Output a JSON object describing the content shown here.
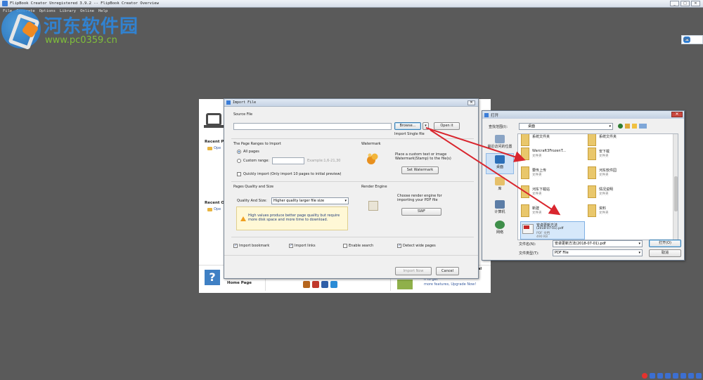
{
  "app": {
    "title": "FlipBook Creator Unregistered 3.9.2  -- FlipBook Creator Overview",
    "menu": [
      "File",
      "Generate",
      "Options",
      "Library",
      "Online",
      "Help"
    ],
    "window_buttons": [
      "_",
      "□",
      "✕"
    ]
  },
  "watermark": {
    "name": "河东软件园",
    "url": "www.pc0359.cn"
  },
  "right_badge": {
    "label": "相关"
  },
  "welcome": {
    "recent_projects_label": "Recent P",
    "recent_projects_open": "Ope",
    "recent_output_label": "Recent O",
    "recent_output_open": "Ope",
    "home_page": "Home Page",
    "help_icon": "?",
    "upgrade_partial_title": "al",
    "upgrade_text_line1": "n to get",
    "upgrade_text_line2": "more features, Upgrade Now!"
  },
  "import_dialog": {
    "title": "Import File",
    "close": "✕",
    "source_file_label": "Source File",
    "source_file_value": "",
    "browse_button": "Browse...",
    "open_it_button": "Open it",
    "import_single_file": "Import Single file",
    "page_ranges_label": "The Page Ranges to Import",
    "all_pages": "All pages",
    "custom_range": "Custom range:",
    "custom_range_example": "Example:1,6-21,30",
    "quickly_import": "Quickly import (Only import 10 pages to  initial  preview)",
    "watermark_label": "Watermark",
    "watermark_desc": "Place a custom text or image Watermark(Stamp) to the file(s)",
    "set_watermark_button": "Set Watermark",
    "quality_label": "Pages Quality and Size",
    "quality_and_size": "Quality And Size:",
    "quality_selected": "Higher quality larger file size",
    "quality_warning": "High values produce better page quality but require more disk space and more time to download.",
    "render_label": "Render Engine",
    "render_desc": "Choose render engine for importing your PDF file",
    "swf_button": "SWF",
    "import_bookmark": "Import bookmark",
    "import_links": "Import links",
    "enable_search": "Enable search",
    "detect_wide_pages": "Detect wide pages",
    "import_now_button": "Import Now",
    "cancel_button": "Cancel",
    "checks": {
      "import_bookmark": true,
      "import_links": true,
      "enable_search": false,
      "detect_wide_pages": true,
      "quickly_import": false
    },
    "all_pages_selected": true
  },
  "open_dialog": {
    "title": "打开",
    "look_in_label": "查找范围(I):",
    "look_in_value": "桌面",
    "places": [
      "最近访问的位置",
      "桌面",
      "库",
      "计算机",
      "网络"
    ],
    "files": [
      {
        "name": "系统文件夹",
        "type": "",
        "row": 0,
        "col": 0
      },
      {
        "name": "系统文件夹",
        "type": "",
        "row": 0,
        "col": 1
      },
      {
        "name": "Warcraft3FrozenT...",
        "type": "文件夹",
        "row": 1,
        "col": 0
      },
      {
        "name": "安下载",
        "type": "文件夹",
        "row": 1,
        "col": 1
      },
      {
        "name": "要传上传",
        "type": "文件夹",
        "row": 2,
        "col": 0
      },
      {
        "name": "河东软件园",
        "type": "文件夹",
        "row": 2,
        "col": 1
      },
      {
        "name": "河东下载站",
        "type": "文件夹",
        "row": 3,
        "col": 0
      },
      {
        "name": "情况说明",
        "type": "文件夹",
        "row": 3,
        "col": 1
      },
      {
        "name": "新建",
        "type": "文件夹",
        "row": 4,
        "col": 0
      },
      {
        "name": "资料",
        "type": "文件夹",
        "row": 4,
        "col": 1
      },
      {
        "name": "安卓更新方法",
        "type": "(2018-07-01).pdf",
        "size": "PDF 文档",
        "extra": "490 KB",
        "row": 5,
        "col": 0
      }
    ],
    "filename_label": "文件名(N):",
    "filename_value": "安卓更新方法(2018-07-01).pdf",
    "filetype_label": "文件类型(T):",
    "filetype_value": "PDF File",
    "open_button": "打开(O)",
    "cancel_button": "取消",
    "close": "✕"
  },
  "colors": {
    "desktop": "#5a5a5a",
    "arrow": "#d9262e",
    "accent": "#3b7dd8"
  }
}
